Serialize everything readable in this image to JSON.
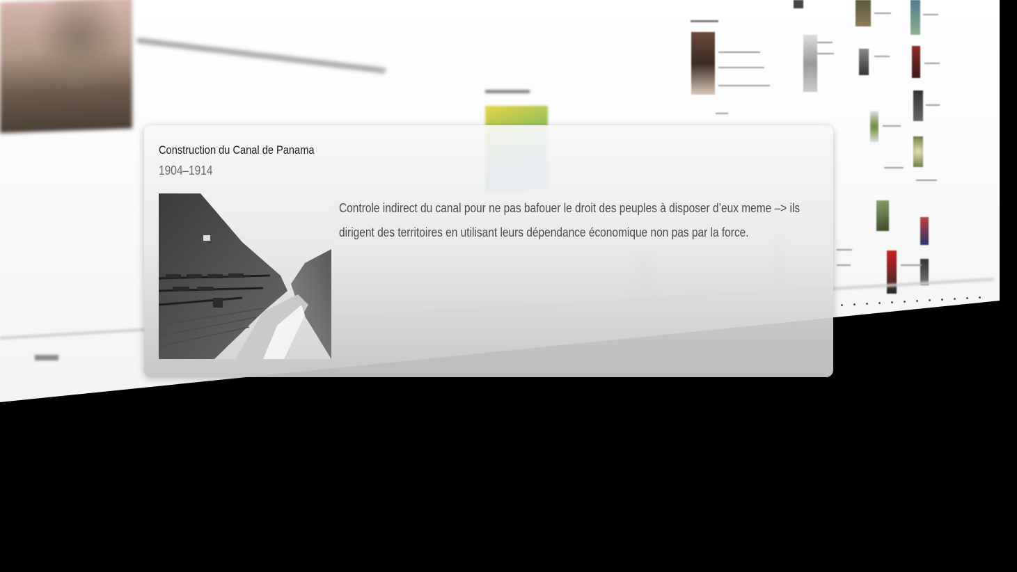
{
  "popup": {
    "title": "Construction du Canal de Panama",
    "date": "1904–1914",
    "description": "Controle indirect du canal pour ne pas bafouer le droit des peuples à disposer d’eux meme –> ils dirigent des territoires en utilisant leurs dépendance économique non pas par la force.",
    "image_alt": "Photographie noir et blanc du chantier du canal de Panama"
  }
}
